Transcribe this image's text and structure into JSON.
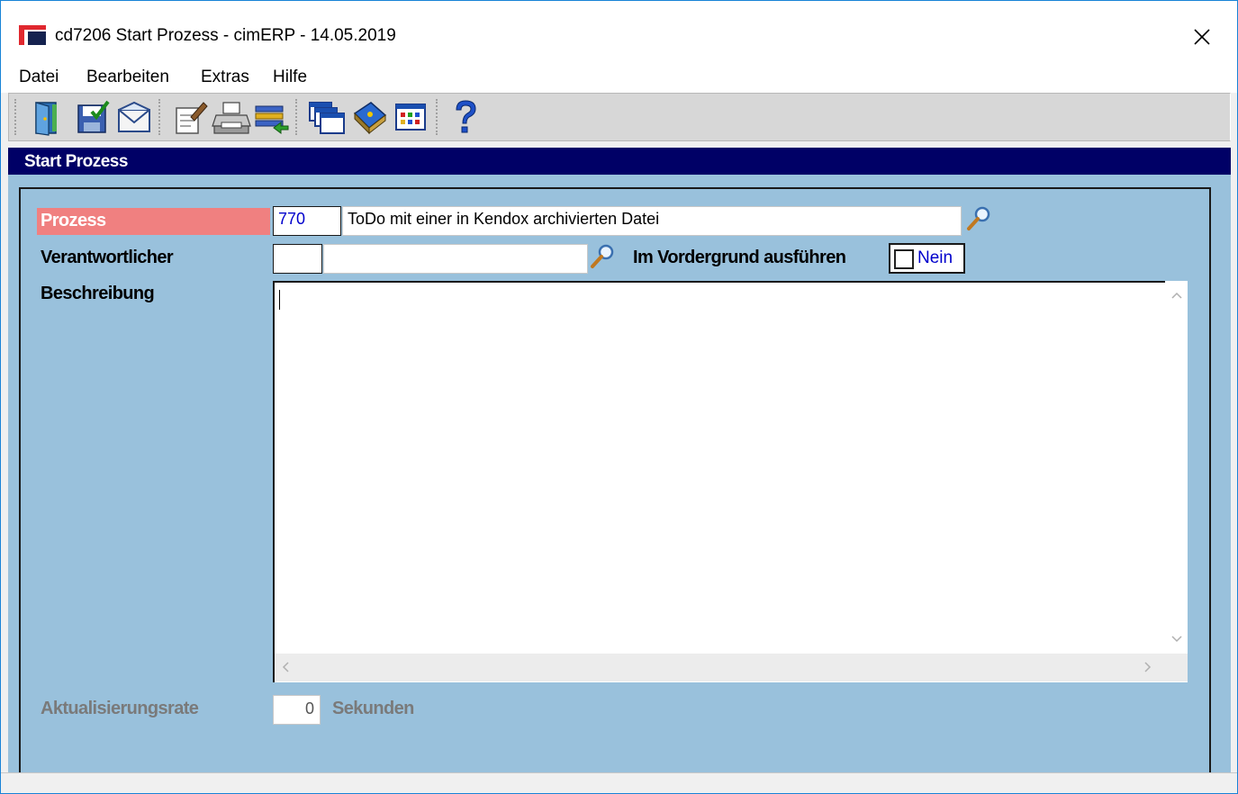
{
  "window": {
    "title": "cd7206 Start Prozess - cimERP - 14.05.2019"
  },
  "menu": {
    "items": [
      "Datei",
      "Bearbeiten",
      "Extras",
      "Hilfe"
    ]
  },
  "toolbar": {
    "buttons": [
      "exit-icon",
      "save-icon",
      "mail-icon",
      "edit-icon",
      "print-icon",
      "export-icon",
      "windows-icon",
      "book-icon",
      "grid-icon",
      "help-icon"
    ]
  },
  "section": {
    "title": "Start Prozess"
  },
  "form": {
    "prozess": {
      "label": "Prozess",
      "code": "770",
      "name": "ToDo mit einer in Kendox archivierten Datei"
    },
    "verantwortlicher": {
      "label": "Verantwortlicher",
      "code": "",
      "name": ""
    },
    "vordergrund": {
      "label": "Im Vordergrund ausführen",
      "checked": false,
      "value_text": "Nein"
    },
    "beschreibung": {
      "label": "Beschreibung",
      "value": ""
    },
    "aktualisierungsrate": {
      "label": "Aktualisierungsrate",
      "value": "0",
      "unit": "Sekunden"
    }
  },
  "colors": {
    "panel_bg": "#99c1dc",
    "header_bg": "#000066",
    "required_label_bg": "#f08080",
    "link_blue": "#0000cc"
  }
}
